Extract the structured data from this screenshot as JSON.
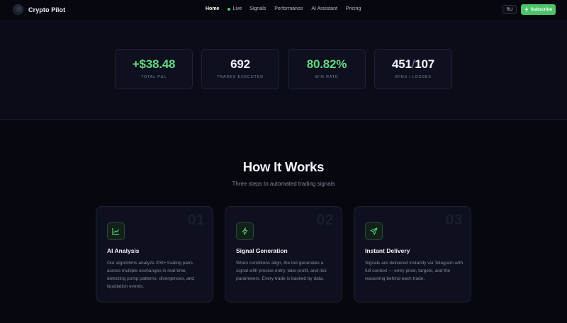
{
  "brand": {
    "name": "Crypto Pilot"
  },
  "nav": {
    "links": [
      "Home",
      "Live",
      "Signals",
      "Performance",
      "AI Assistant",
      "Pricing"
    ],
    "lang_label": "RU",
    "subscribe_label": "Subscribe",
    "live_color": "#4ad66d"
  },
  "stats": [
    {
      "value": "+$38.48",
      "label": "TOTAL P&L",
      "color": "#63d97f"
    },
    {
      "value": "692",
      "label": "TRADES EXECUTED",
      "color": "#f2f3f8"
    },
    {
      "value": "80.82%",
      "label": "WIN RATE",
      "color": "#63d97f"
    },
    {
      "wins": "451",
      "sep": "/",
      "losses": "107",
      "label": "WINS / LOSSES"
    }
  ],
  "how": {
    "title": "How It Works",
    "subtitle": "Three steps to automated trading signals",
    "cards": [
      {
        "number": "01",
        "icon": "chart-line-icon",
        "title": "AI Analysis",
        "description": "Our algorithms analyze 200+ trading pairs across multiple exchanges in real-time, detecting pump patterns, divergences, and liquidation events."
      },
      {
        "number": "02",
        "icon": "lightning-icon",
        "title": "Signal Generation",
        "description": "When conditions align, the bot generates a signal with precise entry, take-profit, and risk parameters. Every trade is backed by data."
      },
      {
        "number": "03",
        "icon": "send-icon",
        "title": "Instant Delivery",
        "description": "Signals are delivered instantly via Telegram with full context — entry price, targets, and the reasoning behind each trade."
      }
    ]
  },
  "accent": "#4cc46a"
}
